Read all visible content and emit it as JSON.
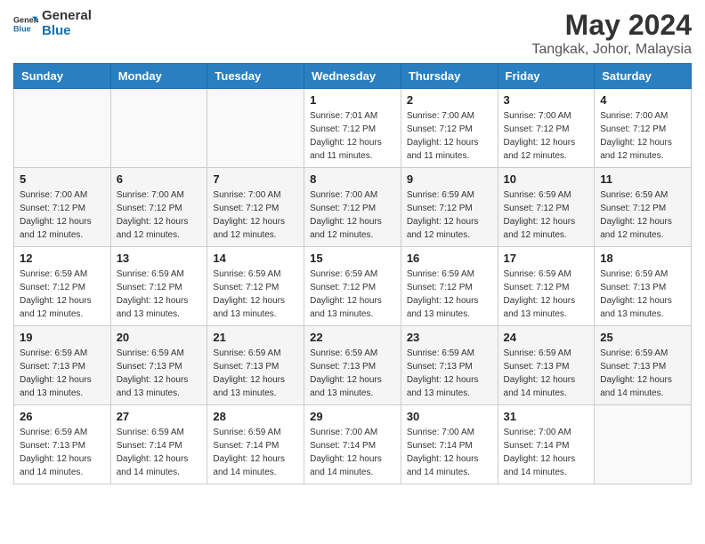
{
  "header": {
    "logo_line1": "General",
    "logo_line2": "Blue",
    "month_year": "May 2024",
    "location": "Tangkak, Johor, Malaysia"
  },
  "weekdays": [
    "Sunday",
    "Monday",
    "Tuesday",
    "Wednesday",
    "Thursday",
    "Friday",
    "Saturday"
  ],
  "weeks": [
    [
      {
        "day": "",
        "info": ""
      },
      {
        "day": "",
        "info": ""
      },
      {
        "day": "",
        "info": ""
      },
      {
        "day": "1",
        "info": "Sunrise: 7:01 AM\nSunset: 7:12 PM\nDaylight: 12 hours and 11 minutes."
      },
      {
        "day": "2",
        "info": "Sunrise: 7:00 AM\nSunset: 7:12 PM\nDaylight: 12 hours and 11 minutes."
      },
      {
        "day": "3",
        "info": "Sunrise: 7:00 AM\nSunset: 7:12 PM\nDaylight: 12 hours and 12 minutes."
      },
      {
        "day": "4",
        "info": "Sunrise: 7:00 AM\nSunset: 7:12 PM\nDaylight: 12 hours and 12 minutes."
      }
    ],
    [
      {
        "day": "5",
        "info": "Sunrise: 7:00 AM\nSunset: 7:12 PM\nDaylight: 12 hours and 12 minutes."
      },
      {
        "day": "6",
        "info": "Sunrise: 7:00 AM\nSunset: 7:12 PM\nDaylight: 12 hours and 12 minutes."
      },
      {
        "day": "7",
        "info": "Sunrise: 7:00 AM\nSunset: 7:12 PM\nDaylight: 12 hours and 12 minutes."
      },
      {
        "day": "8",
        "info": "Sunrise: 7:00 AM\nSunset: 7:12 PM\nDaylight: 12 hours and 12 minutes."
      },
      {
        "day": "9",
        "info": "Sunrise: 6:59 AM\nSunset: 7:12 PM\nDaylight: 12 hours and 12 minutes."
      },
      {
        "day": "10",
        "info": "Sunrise: 6:59 AM\nSunset: 7:12 PM\nDaylight: 12 hours and 12 minutes."
      },
      {
        "day": "11",
        "info": "Sunrise: 6:59 AM\nSunset: 7:12 PM\nDaylight: 12 hours and 12 minutes."
      }
    ],
    [
      {
        "day": "12",
        "info": "Sunrise: 6:59 AM\nSunset: 7:12 PM\nDaylight: 12 hours and 12 minutes."
      },
      {
        "day": "13",
        "info": "Sunrise: 6:59 AM\nSunset: 7:12 PM\nDaylight: 12 hours and 13 minutes."
      },
      {
        "day": "14",
        "info": "Sunrise: 6:59 AM\nSunset: 7:12 PM\nDaylight: 12 hours and 13 minutes."
      },
      {
        "day": "15",
        "info": "Sunrise: 6:59 AM\nSunset: 7:12 PM\nDaylight: 12 hours and 13 minutes."
      },
      {
        "day": "16",
        "info": "Sunrise: 6:59 AM\nSunset: 7:12 PM\nDaylight: 12 hours and 13 minutes."
      },
      {
        "day": "17",
        "info": "Sunrise: 6:59 AM\nSunset: 7:12 PM\nDaylight: 12 hours and 13 minutes."
      },
      {
        "day": "18",
        "info": "Sunrise: 6:59 AM\nSunset: 7:13 PM\nDaylight: 12 hours and 13 minutes."
      }
    ],
    [
      {
        "day": "19",
        "info": "Sunrise: 6:59 AM\nSunset: 7:13 PM\nDaylight: 12 hours and 13 minutes."
      },
      {
        "day": "20",
        "info": "Sunrise: 6:59 AM\nSunset: 7:13 PM\nDaylight: 12 hours and 13 minutes."
      },
      {
        "day": "21",
        "info": "Sunrise: 6:59 AM\nSunset: 7:13 PM\nDaylight: 12 hours and 13 minutes."
      },
      {
        "day": "22",
        "info": "Sunrise: 6:59 AM\nSunset: 7:13 PM\nDaylight: 12 hours and 13 minutes."
      },
      {
        "day": "23",
        "info": "Sunrise: 6:59 AM\nSunset: 7:13 PM\nDaylight: 12 hours and 13 minutes."
      },
      {
        "day": "24",
        "info": "Sunrise: 6:59 AM\nSunset: 7:13 PM\nDaylight: 12 hours and 14 minutes."
      },
      {
        "day": "25",
        "info": "Sunrise: 6:59 AM\nSunset: 7:13 PM\nDaylight: 12 hours and 14 minutes."
      }
    ],
    [
      {
        "day": "26",
        "info": "Sunrise: 6:59 AM\nSunset: 7:13 PM\nDaylight: 12 hours and 14 minutes."
      },
      {
        "day": "27",
        "info": "Sunrise: 6:59 AM\nSunset: 7:14 PM\nDaylight: 12 hours and 14 minutes."
      },
      {
        "day": "28",
        "info": "Sunrise: 6:59 AM\nSunset: 7:14 PM\nDaylight: 12 hours and 14 minutes."
      },
      {
        "day": "29",
        "info": "Sunrise: 7:00 AM\nSunset: 7:14 PM\nDaylight: 12 hours and 14 minutes."
      },
      {
        "day": "30",
        "info": "Sunrise: 7:00 AM\nSunset: 7:14 PM\nDaylight: 12 hours and 14 minutes."
      },
      {
        "day": "31",
        "info": "Sunrise: 7:00 AM\nSunset: 7:14 PM\nDaylight: 12 hours and 14 minutes."
      },
      {
        "day": "",
        "info": ""
      }
    ]
  ]
}
